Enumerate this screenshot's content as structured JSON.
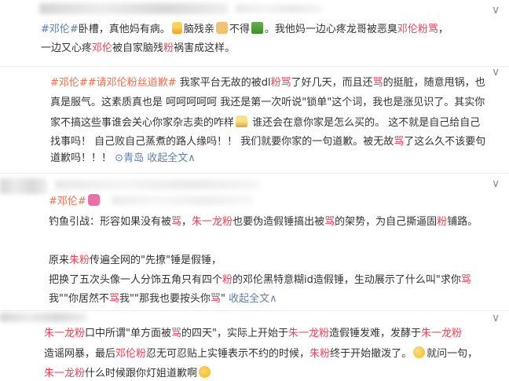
{
  "post1": {
    "chevron": "∨",
    "line1": {
      "tag": "#邓伦#",
      "t1": "卧槽，真他妈有病。",
      "t2": "脑残亲",
      "t3": "不得",
      "t4": "。我他妈一边心疼龙哥被恶臭",
      "hl": "邓伦粉骂",
      "t5": "，"
    },
    "line2": {
      "t1": "一边又心疼",
      "hl1": "邓伦",
      "t2": "被自家脑残",
      "hl2": "粉",
      "t3": "祸害成这样。"
    }
  },
  "post2": {
    "chevron": "∨",
    "line1": {
      "tag": "#邓伦##请邓伦粉丝道歉#",
      "t1": " 我家平台无故的被dl",
      "hl1": "粉骂",
      "t2": "了好几天，而且还",
      "hl2": "骂",
      "t3": "的挺脏，随意甩锅，也"
    },
    "line2": "真是服气。这素质真也是 呵呵呵呵呵  我还是第一次听说\"锁单\"这个词，我也是涨见识了。其实你",
    "line3a": "家不搞这些事谁会关心你家杂志卖的咋样",
    "line3b": " 谁还会在意你家是怎么买的。 这不就是自己给自己",
    "line4": "找事吗！ 自己败自己蒸煮的路人缘吗！！  我们就要你家的一句道歉。被无故",
    "line4hl": "骂",
    "line4b": "了这么久不该要句",
    "line5": "道歉吗！！！",
    "location": "青岛",
    "more": "收起全文∧"
  },
  "post3": {
    "chevron": "∨",
    "tag": "#邓伦#",
    "p1": {
      "t1": "钓鱼引战：形容如果没有被",
      "hl1": "骂",
      "t2": "，",
      "hl2": "朱一龙粉",
      "t3": "也要伪造假锤搞出被",
      "hl3": "骂",
      "t4": "的架势，为自己撕逼固",
      "hl4": "粉",
      "t5": "铺路。"
    },
    "p2l1": {
      "t1": "原来",
      "hl1": "朱粉",
      "t2": "传遍全网的\"先撩\"锤是假锤，"
    },
    "p2l2": {
      "t1": "把换了五次头像一人分饰五角只有四个",
      "hl1": "粉",
      "t2": "的邓伦黑特意糊id造假锤，生动展示了什么叫\"求你",
      "hl2": "骂"
    },
    "p2l3": {
      "t1": "我\"\"你居然不",
      "hl1": "骂",
      "t2": "我\"\"那我也要按头你",
      "hl2": "骂",
      "t3": "\"",
      "more": "收起全文∧"
    }
  },
  "post4": {
    "chevron": "∨",
    "l1": {
      "hl1": "朱一龙粉",
      "t1": "口中所谓\"单方面被",
      "hl2": "骂",
      "t2": "的四天\"，实际上开始于",
      "hl3": "朱一龙粉",
      "t3": "造假锤发难，发酵于",
      "hl4": "朱一龙粉"
    },
    "l2": {
      "t1": "造谣网暴，最后",
      "hl1": "邓伦粉",
      "t2": "忍无可忍贴上实锤表示不约的时候，",
      "hl2": "朱粉",
      "t3": "终于开始撤泼了。",
      "t4": "就问一句，"
    },
    "l3": {
      "hl1": "朱一龙粉",
      "t1": "什么时候跟你灯姐道歉啊"
    }
  },
  "colors": {
    "highlight": "#e8455b",
    "tag": "#eb7350",
    "link": "#5d7fb0"
  }
}
